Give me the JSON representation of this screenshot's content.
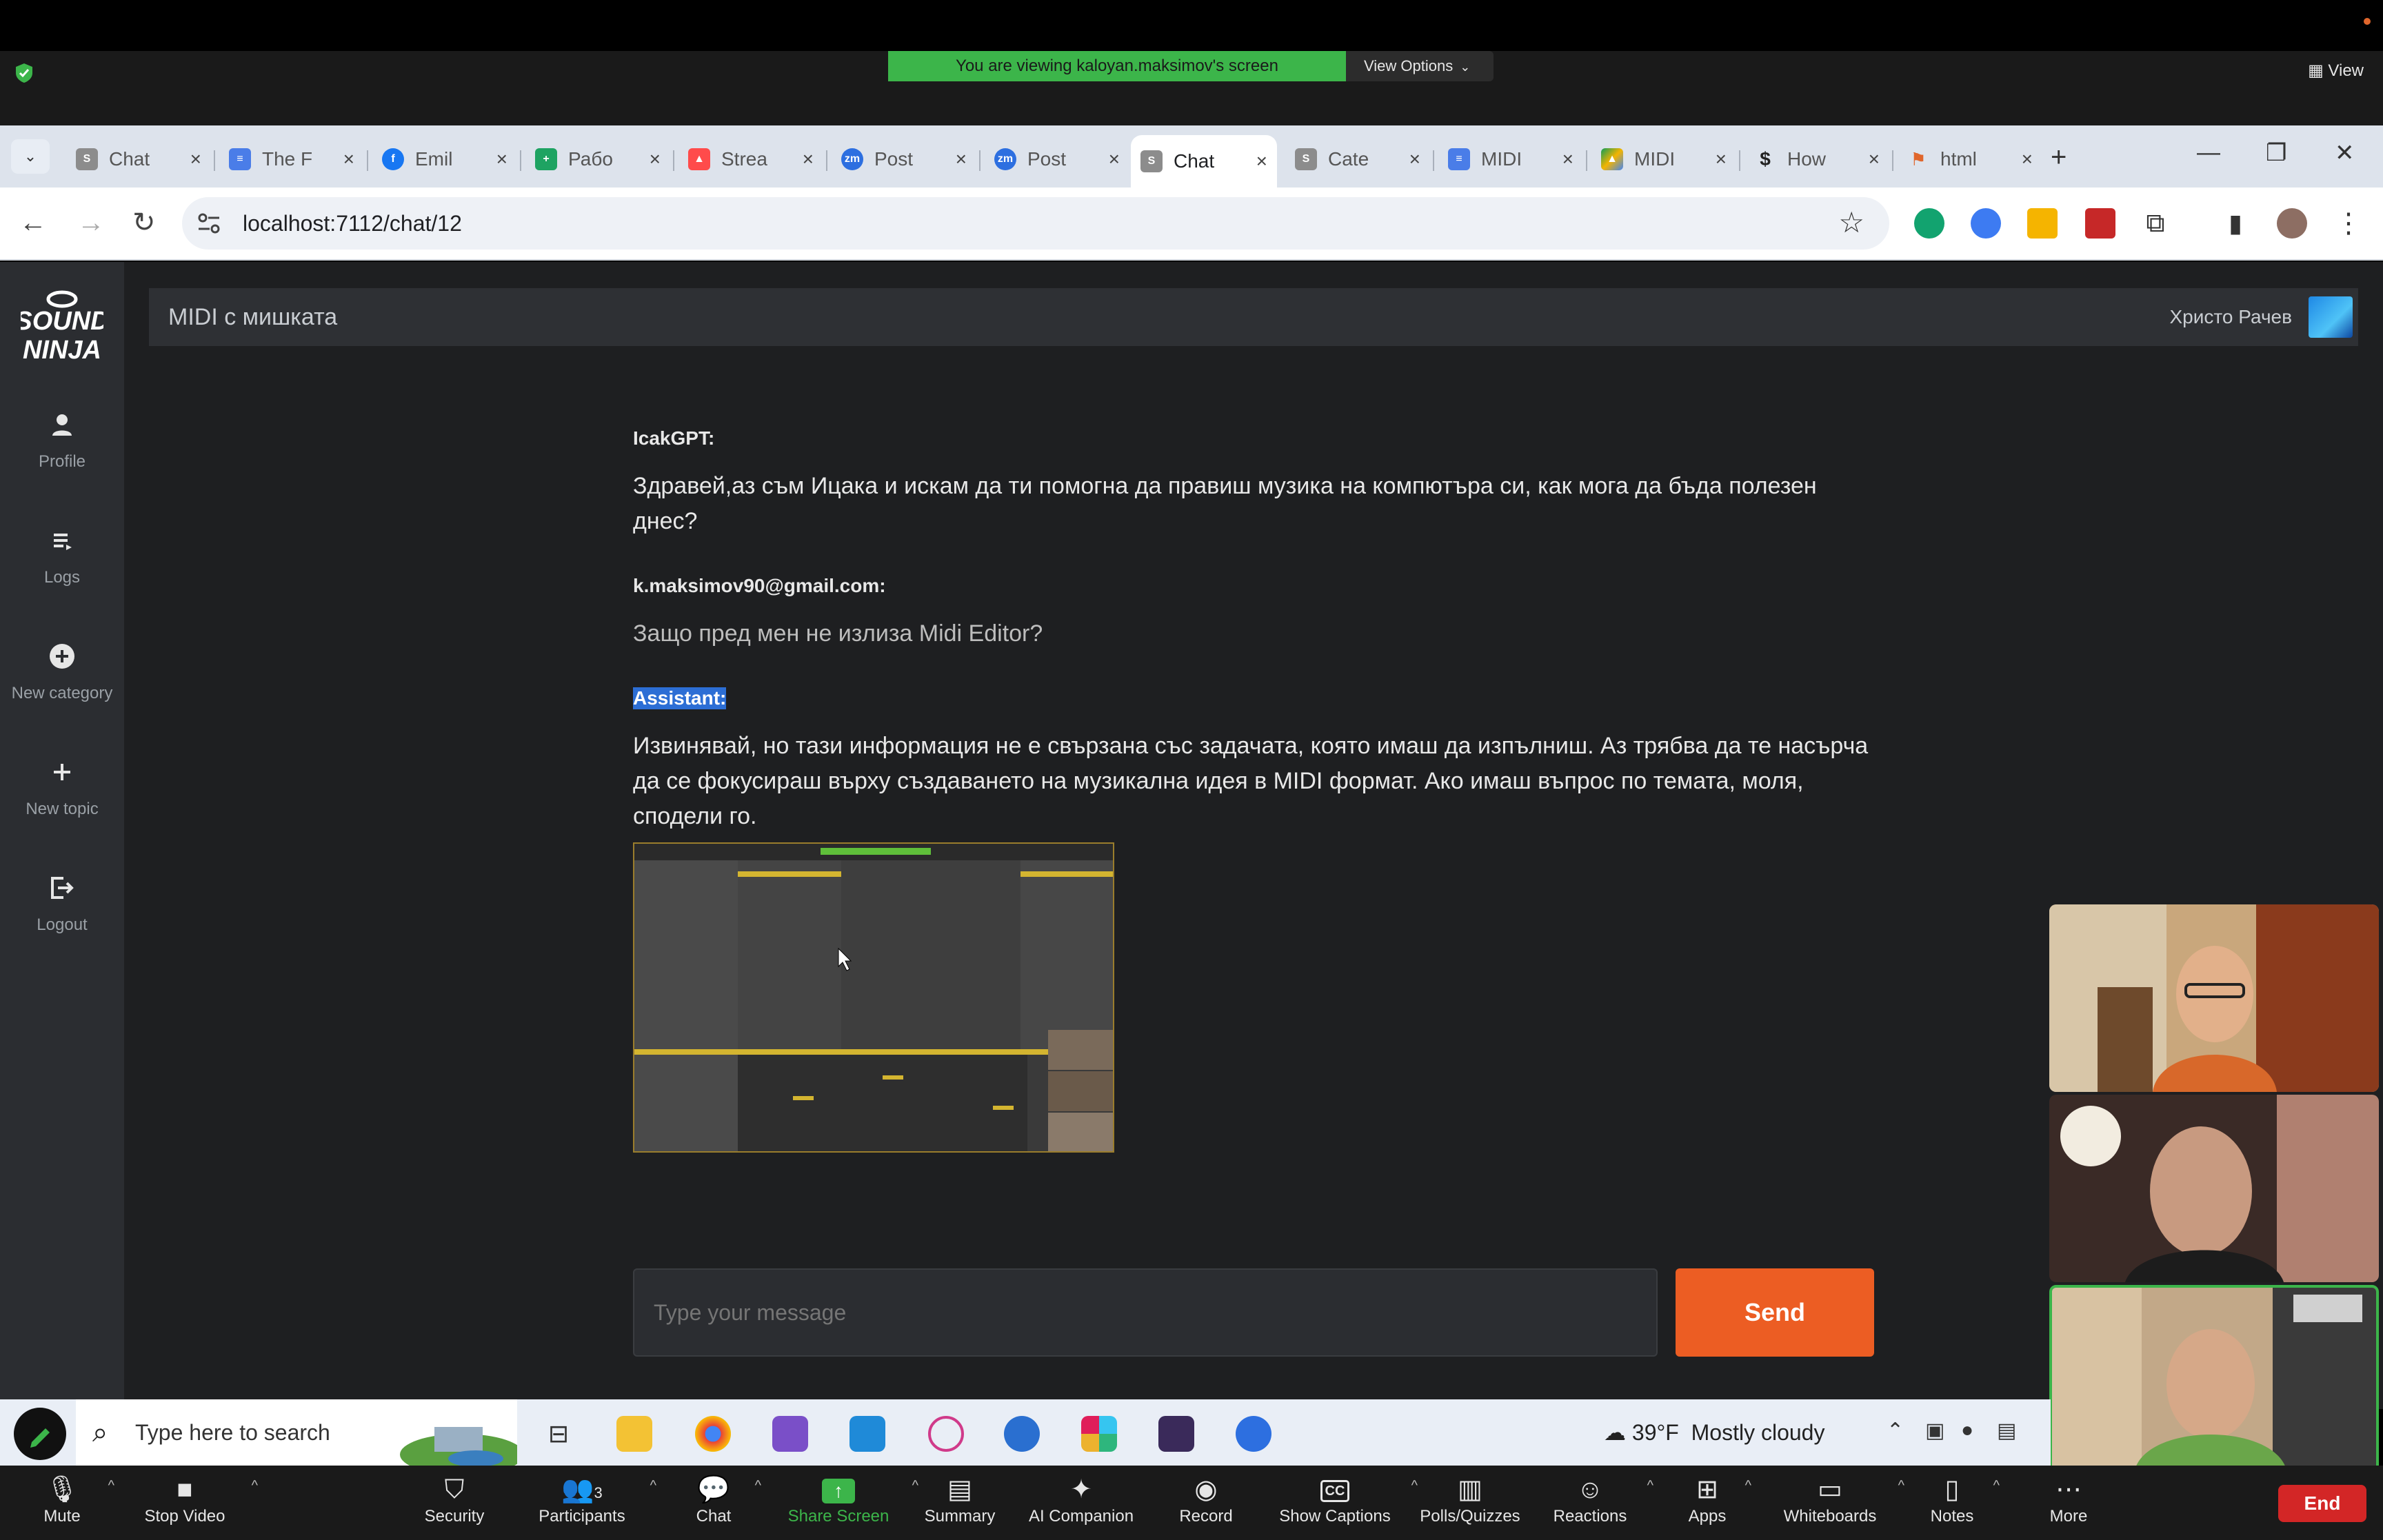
{
  "zoom_share": {
    "banner": "You are viewing kaloyan.maksimov's screen",
    "view_options": "View Options",
    "view": "View"
  },
  "browser": {
    "tabs": [
      {
        "label": "Chat",
        "active": false,
        "icon": "soundninja-favicon"
      },
      {
        "label": "The F",
        "active": false,
        "icon": "google-docs-favicon"
      },
      {
        "label": "Emil",
        "active": false,
        "icon": "facebook-favicon"
      },
      {
        "label": "Рабо",
        "active": false,
        "icon": "google-sheets-favicon"
      },
      {
        "label": "Strea",
        "active": false,
        "icon": "streamlit-favicon"
      },
      {
        "label": "Post",
        "active": false,
        "icon": "zoom-favicon"
      },
      {
        "label": "Post",
        "active": false,
        "icon": "zoom-favicon"
      },
      {
        "label": "Chat",
        "active": true,
        "icon": "soundninja-favicon"
      },
      {
        "label": "Cate",
        "active": false,
        "icon": "soundninja-favicon"
      },
      {
        "label": "MIDI",
        "active": false,
        "icon": "google-docs-favicon"
      },
      {
        "label": "MIDI",
        "active": false,
        "icon": "google-drive-favicon"
      },
      {
        "label": "How",
        "active": false,
        "icon": "dollar-favicon"
      },
      {
        "label": "html",
        "active": false,
        "icon": "html-favicon"
      }
    ],
    "url": "localhost:7112/chat/12"
  },
  "app": {
    "chat_title": "MIDI с мишката",
    "user_name": "Христо Рачев",
    "logo_text": "SOUND NINJA",
    "sidebar": [
      {
        "label": "Profile",
        "icon": "person-icon"
      },
      {
        "label": "Logs",
        "icon": "list-icon"
      },
      {
        "label": "New category",
        "icon": "plus-circle-icon"
      },
      {
        "label": "New topic",
        "icon": "plus-icon"
      },
      {
        "label": "Logout",
        "icon": "logout-icon"
      }
    ],
    "messages": [
      {
        "author": "IcakGPT:",
        "text": "Здравей,аз съм Ицака и искам да ти помогна да правиш музика на компютъра си, как мога да бъда полезен днес?"
      },
      {
        "author": "k.maksimov90@gmail.com:",
        "text": "Защо пред мен не излиза Midi Editor?"
      },
      {
        "author": "Assistant:",
        "text": "Извинявай, но тази информация не е свързана със задачата, която имаш да изпълниш. Аз трябва да те насърча да се фокусираш върху създаването на музикална идея в MIDI формат. Ако имаш въпрос по темата, моля, сподели го."
      }
    ],
    "input_placeholder": "Type your message",
    "send_label": "Send"
  },
  "taskbar": {
    "search_placeholder": "Type here to search",
    "weather_temp": "39°F",
    "weather_desc": "Mostly cloudy"
  },
  "zoom_toolbar": {
    "mute": "Mute",
    "stop_video": "Stop Video",
    "security": "Security",
    "participants": "Participants",
    "participants_count": "3",
    "chat": "Chat",
    "share_screen": "Share Screen",
    "summary": "Summary",
    "ai_companion": "AI Companion",
    "record": "Record",
    "show_captions": "Show Captions",
    "polls": "Polls/Quizzes",
    "reactions": "Reactions",
    "apps": "Apps",
    "whiteboards": "Whiteboards",
    "notes": "Notes",
    "more": "More",
    "end": "End"
  },
  "colors": {
    "share_green": "#3cb54a",
    "send_orange": "#ec5d23",
    "end_red": "#d32626",
    "app_bg": "#1e1f21",
    "selection_blue": "#2c6ed5"
  }
}
